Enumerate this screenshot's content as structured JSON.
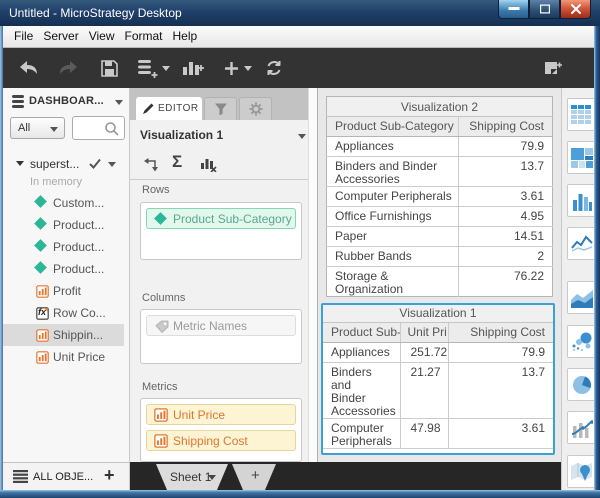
{
  "window": {
    "title": "Untitled - MicroStrategy Desktop"
  },
  "menu": {
    "items": [
      "File",
      "Server",
      "View",
      "Format",
      "Help"
    ]
  },
  "toolbar": {
    "icon_names": [
      "back-icon",
      "forward-icon",
      "save-icon",
      "add-data-icon",
      "add-visualization-icon",
      "add-icon",
      "refresh-icon",
      "new-page-icon",
      "panel-icon"
    ]
  },
  "sidebar": {
    "header": "DASHBOAR...",
    "filter_all": "All",
    "dataset": "superst...",
    "dataset_status": "In memory",
    "attributes": [
      "Custom...",
      "Product...",
      "Product...",
      "Product..."
    ],
    "metric_items": [
      "Profit",
      "Row Co...",
      "Shippin...",
      "Unit Price"
    ],
    "fx_label": "fx",
    "all_objects": "ALL OBJE..."
  },
  "editor": {
    "tab_label": "EDITOR",
    "viz_name": "Visualization 1",
    "rows_label": "Rows",
    "rows_item": "Product Sub-Category",
    "columns_label": "Columns",
    "columns_item": "Metric Names",
    "metrics_label": "Metrics",
    "metrics_items": [
      "Unit Price",
      "Shipping Cost"
    ],
    "sigma_glyph": "Σ"
  },
  "chart_data": [
    {
      "type": "table",
      "title": "Visualization 2",
      "columns": [
        "Product Sub-Category",
        "Shipping Cost"
      ],
      "rows": [
        [
          "Appliances",
          "79.9"
        ],
        [
          "Binders and Binder Accessories",
          "13.7"
        ],
        [
          "Computer Peripherals",
          "3.61"
        ],
        [
          "Office Furnishings",
          "4.95"
        ],
        [
          "Paper",
          "14.51"
        ],
        [
          "Rubber Bands",
          "2"
        ],
        [
          "Storage & Organization",
          "76.22"
        ]
      ]
    },
    {
      "type": "table",
      "title": "Visualization 1",
      "selected": true,
      "columns": [
        "Product Sub-",
        "Unit Pri",
        "Shipping Cost"
      ],
      "rows": [
        [
          "Appliances",
          "251.72",
          "79.9"
        ],
        [
          "Binders and Binder Accessories",
          "21.27",
          "13.7"
        ],
        [
          "Computer Peripherals",
          "47.98",
          "3.61"
        ]
      ]
    }
  ],
  "gallery": {
    "icons": [
      "grid",
      "heatmap",
      "bar-chart",
      "line-chart",
      "area-chart",
      "bubble-chart",
      "pie-chart",
      "combo-chart",
      "map"
    ]
  },
  "sheetbar": {
    "tab": "Sheet 1"
  }
}
